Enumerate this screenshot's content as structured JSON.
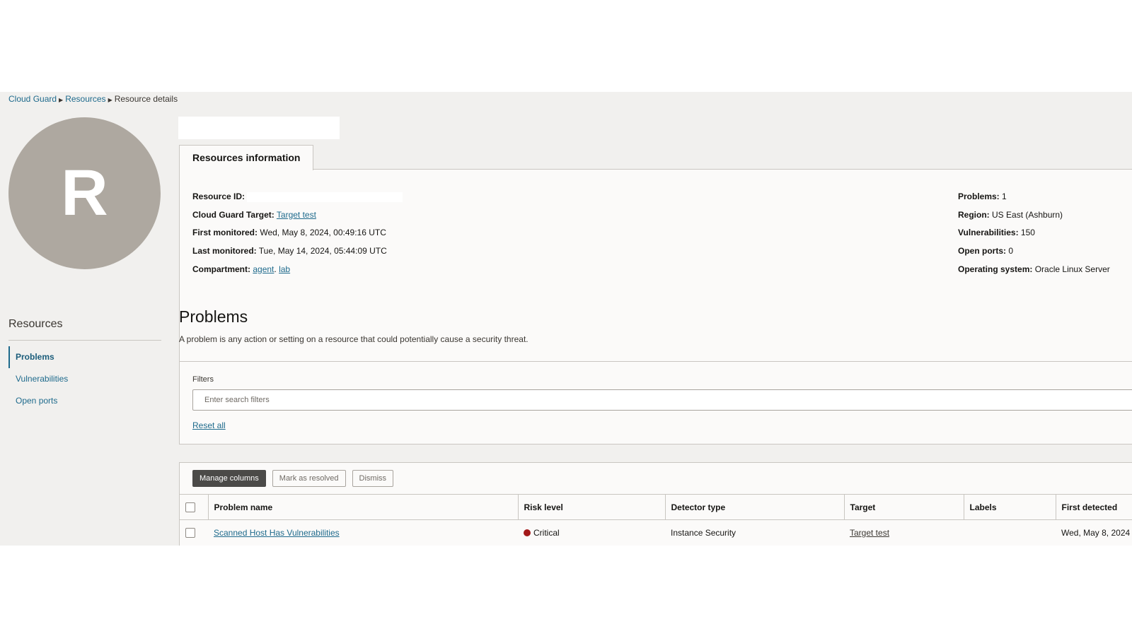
{
  "breadcrumb": {
    "items": [
      "Cloud Guard",
      "Resources"
    ],
    "current": "Resource details"
  },
  "avatar": {
    "letter": "R"
  },
  "tab": {
    "label": "Resources information"
  },
  "info": {
    "left": [
      {
        "label": "Resource ID:",
        "value": ""
      },
      {
        "label": "Cloud Guard Target:",
        "link": "Target test"
      },
      {
        "label": "First monitored:",
        "value": "Wed, May 8, 2024, 00:49:16 UTC"
      },
      {
        "label": "Last monitored:",
        "value": "Tue, May 14, 2024, 05:44:09 UTC"
      },
      {
        "label": "Compartment:",
        "link": "agent",
        "link2": "lab"
      }
    ],
    "right": [
      {
        "label": "Problems:",
        "value": "1"
      },
      {
        "label": "Region:",
        "value": "US East (Ashburn)"
      },
      {
        "label": "Vulnerabilities:",
        "value": "150"
      },
      {
        "label": "Open ports:",
        "value": "0"
      },
      {
        "label": "Operating system:",
        "value": "Oracle Linux Server"
      }
    ]
  },
  "sidebar": {
    "title": "Resources",
    "items": [
      {
        "label": "Problems",
        "active": true
      },
      {
        "label": "Vulnerabilities",
        "active": false
      },
      {
        "label": "Open ports",
        "active": false
      }
    ]
  },
  "problems": {
    "title": "Problems",
    "description": "A problem is any action or setting on a resource that could potentially cause a security threat.",
    "filters_label": "Filters",
    "search_placeholder": "Enter search filters",
    "reset_label": "Reset all",
    "buttons": {
      "manage_columns": "Manage columns",
      "mark_resolved": "Mark as resolved",
      "dismiss": "Dismiss"
    },
    "columns": [
      "Problem name",
      "Risk level",
      "Detector type",
      "Target",
      "Labels",
      "First detected"
    ],
    "rows": [
      {
        "problem_name": "Scanned Host Has Vulnerabilities",
        "risk_level": "Critical",
        "risk_color": "#a3191a",
        "detector_type": "Instance Security",
        "target": "Target test",
        "labels": "",
        "first_detected": "Wed, May 8, 2024"
      }
    ]
  },
  "colors": {
    "accent": "#1e6a8c",
    "background": "#f1f0ee",
    "panel": "#fbfaf9",
    "avatar": "#aea8a0",
    "critical": "#a3191a"
  }
}
